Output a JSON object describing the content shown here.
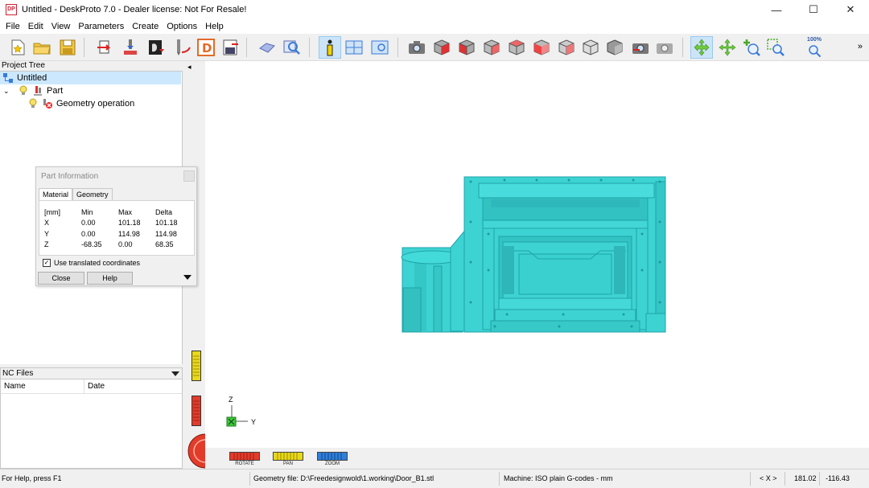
{
  "window": {
    "logo_text": "DP",
    "title": "Untitled - DeskProto 7.0 - Dealer license: Not For Resale!",
    "minimize": "—",
    "maximize": "☐",
    "close": "✕"
  },
  "menu": {
    "items": [
      "File",
      "Edit",
      "View",
      "Parameters",
      "Create",
      "Options",
      "Help"
    ]
  },
  "toolbar": {
    "zoom_label": "100%",
    "more": "»"
  },
  "project_tree": {
    "header": "Project Tree",
    "root": "Untitled",
    "part": "Part",
    "operation": "Geometry operation"
  },
  "nc_files": {
    "header": "NC Files",
    "col_name": "Name",
    "col_date": "Date"
  },
  "part_info": {
    "title": "Part Information",
    "tabs": [
      "Material",
      "Geometry"
    ],
    "headers": [
      "[mm]",
      "Min",
      "Max",
      "Delta"
    ],
    "rows": [
      [
        "X",
        "0.00",
        "101.18",
        "101.18"
      ],
      [
        "Y",
        "0.00",
        "114.98",
        "114.98"
      ],
      [
        "Z",
        "-68.35",
        "0.00",
        "68.35"
      ]
    ],
    "checkbox_label": "Use translated coordinates",
    "checkbox_mark": "✓",
    "close_button": "Close",
    "help_button": "Help"
  },
  "viewport": {
    "axis_z": "Z",
    "axis_y": "Y",
    "rotate_label": "ROTATE",
    "pan_label": "PAN",
    "zoom_label": "ZOOM",
    "collapse_arrow": "◂",
    "colors": {
      "model": "#3ed3d3",
      "model_dark": "#1fa3a8",
      "rotate": "#e33b2a",
      "pan": "#e8d81a",
      "zoom": "#2f7fd8"
    }
  },
  "status": {
    "help": "For Help, press F1",
    "geometry_file": "Geometry file: D:\\Freedesignwold\\1.working\\Door_B1.stl",
    "machine": "Machine: ISO plain G-codes - mm",
    "axes": "< X >",
    "coord1": "181.02",
    "coord2": "-116.43"
  }
}
